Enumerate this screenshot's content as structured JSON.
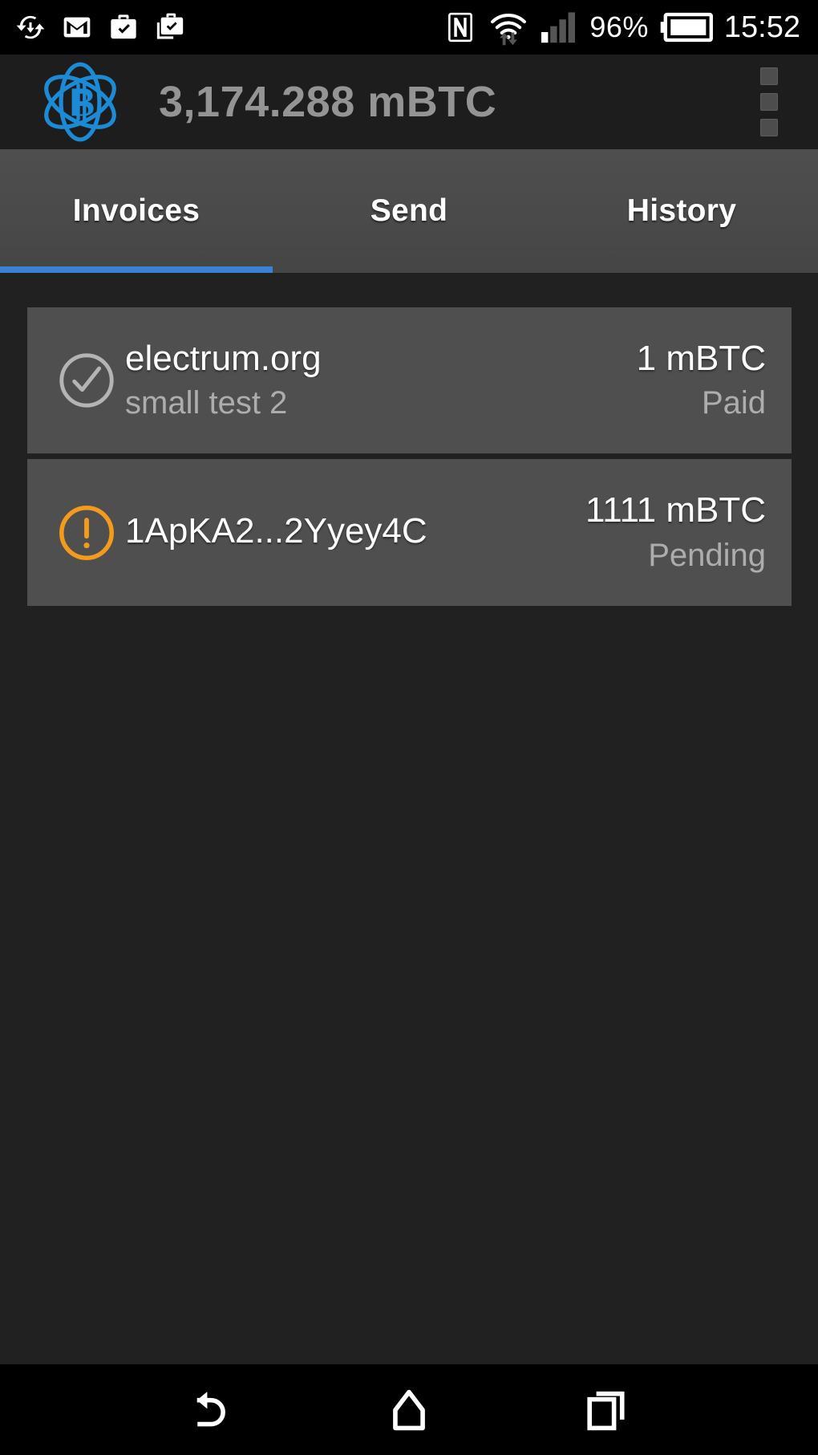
{
  "status_bar": {
    "left_icons": [
      {
        "name": "sync-icon",
        "label": "Sync"
      },
      {
        "name": "gmail-icon",
        "label": "Gmail"
      },
      {
        "name": "work-briefcase-check-icon",
        "label": "Work profile"
      },
      {
        "name": "work-briefcase-check-outline-icon",
        "label": "Work apps"
      }
    ],
    "right_icons": [
      {
        "name": "nfc-icon",
        "label": "NFC"
      },
      {
        "name": "wifi-transfer-icon",
        "label": "Wi-Fi"
      },
      {
        "name": "cell-signal-icon",
        "label": "Signal"
      }
    ],
    "battery_percent": "96%",
    "battery_icon": "battery-full-icon",
    "clock": "15:52"
  },
  "app_bar": {
    "logo_icon": "electrum-logo-icon",
    "balance": "3,174.288 mBTC",
    "overflow_icon": "overflow-menu-icon"
  },
  "tabs": {
    "items": [
      {
        "label": "Invoices",
        "active": true
      },
      {
        "label": "Send",
        "active": false
      },
      {
        "label": "History",
        "active": false
      }
    ],
    "active_index": 0,
    "indicator_color": "#3b82d4"
  },
  "invoices": [
    {
      "icon": "check-circle-icon",
      "icon_color": "#b4b4b4",
      "title": "electrum.org",
      "subtitle": "small test 2",
      "amount": "1 mBTC",
      "status": "Paid"
    },
    {
      "icon": "alert-circle-icon",
      "icon_color": "#f49b1c",
      "title": "1ApKA2...2Yyey4C",
      "subtitle": "",
      "amount": "1111 mBTC",
      "status": "Pending"
    }
  ],
  "nav_bar": {
    "back_icon": "back-arrow-icon",
    "home_icon": "home-icon",
    "recents_icon": "recent-apps-icon"
  },
  "colors": {
    "background": "#212121",
    "app_bar": "#1d1d1d",
    "tab_bar": "#4a4a4a",
    "card": "#4f4f4f",
    "accent": "#3b82d4",
    "logo": "#1c8ad4",
    "warning": "#f49b1c"
  }
}
